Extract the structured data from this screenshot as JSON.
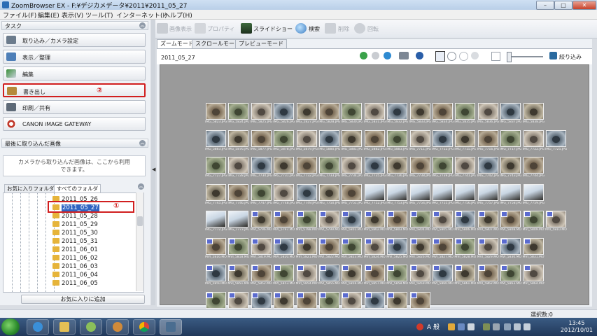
{
  "window": {
    "title": "ZoomBrowser EX  -  F:¥デジカメデータ¥2011¥2011_05_27",
    "min_label": "–",
    "max_label": "□",
    "close_label": "✕"
  },
  "menu": {
    "items": [
      "ファイル(F)",
      "編集(E)",
      "表示(V)",
      "ツール(T)",
      "インターネット(I)",
      "ヘルプ(H)"
    ]
  },
  "left": {
    "task_header": "タスク",
    "tasks": [
      {
        "label": "取り込み／カメラ設定",
        "icon": "camera-import-icon"
      },
      {
        "label": "表示／整理",
        "icon": "view-organize-icon"
      },
      {
        "label": "編集",
        "icon": "edit-icon"
      },
      {
        "label": "書き出し",
        "icon": "export-icon"
      },
      {
        "label": "印刷／共有",
        "icon": "print-icon"
      },
      {
        "label": "CANON iMAGE GATEWAY",
        "icon": "gateway-icon"
      }
    ],
    "export_marker": "②",
    "recent_header": "最後に取り込んだ画像",
    "recent_text_line1": "カメラから取り込んだ画像は、ここから利用",
    "recent_text_line2": "できます。",
    "folder_tabs": [
      "お気に入りフォルダ",
      "すべてのフォルダ"
    ],
    "folders": [
      "2011_05_26",
      "2011_05_27",
      "2011_05_28",
      "2011_05_29",
      "2011_05_30",
      "2011_05_31",
      "2011_06_01",
      "2011_06_02",
      "2011_06_03",
      "2011_06_04",
      "2011_06_05"
    ],
    "selected_folder": "2011_05_27",
    "selected_marker": "①",
    "add_favorite": "お気に入りに追加"
  },
  "toolbar": {
    "view_image": "画像表示",
    "properties": "プロパティ",
    "slideshow": "スライドショー",
    "search": "検索",
    "delete": "削除",
    "rotate": "回転",
    "filter": "絞り込み"
  },
  "main": {
    "tabs": [
      "ズームモード",
      "スクロールモード",
      "プレビューモード"
    ],
    "folder_date": "2011_05_27",
    "status": "選択数:0"
  },
  "thumbnails": {
    "rows": [
      [
        "IMG_5823.JPG",
        "IMG_5824.JPG",
        "IMG_5825.JPG",
        "IMG_5826.JPG",
        "IMG_5827.JPG",
        "IMG_5828.JPG",
        "IMG_5830.JPG",
        "IMG_5831.JPG",
        "IMG_5832.JPG",
        "IMG_5833.JPG",
        "IMG_5834.JPG",
        "IMG_5835.JPG",
        "IMG_5836.JPG",
        "IMG_5837.JPG",
        "IMG_5838.JPG"
      ],
      [
        "IMG_5863.JPG",
        "IMG_5876.JPG",
        "IMG_5877.JPG",
        "IMG_5878.JPG",
        "IMG_5879.JPG",
        "IMG_5880.JPG",
        "IMG_5881.JPG",
        "IMG_5882.JPG",
        "IMG_5883.JPG",
        "IMG_7711.JPG",
        "IMG_7712.JPG",
        "IMG_7715.JPG",
        "IMG_7716.JPG",
        "IMG_7717.JPG",
        "IMG_7722.JPG",
        "IMG_7725.JPG"
      ],
      [
        "IMG_7727.JPG",
        "IMG_7728.JPG",
        "IMG_7730.JPG",
        "IMG_7731.JPG",
        "IMG_7732.JPG",
        "IMG_7733.JPG",
        "IMG_7734.JPG",
        "IMG_7735.JPG",
        "IMG_7736.JPG",
        "IMG_7738.JPG",
        "IMG_7739.JPG",
        "IMG_7741.JPG",
        "IMG_7742.JPG",
        "IMG_7743.JPG",
        "IMG_7744.JPG"
      ],
      [
        "IMG_7745.JPG",
        "IMG_7746.JPG",
        "IMG_7747.JPG",
        "IMG_7748.JPG",
        "IMG_7749.JPG",
        "IMG_7750.JPG",
        "IMG_7751.JPG",
        "IMG_7752.JPG",
        "IMG_7753.JPG",
        "IMG_7754.JPG",
        "IMG_7755.JPG",
        "IMG_7756.JPG",
        "IMG_7757.JPG",
        "IMG_7758.JPG",
        "IMG_7759.JPG"
      ],
      [
        "IMG_7772.JPG",
        "IMG_7773.JPG",
        "MVI_5796.MOV",
        "MVI_5797.MOV",
        "MVI_5798.MOV",
        "MVI_5799.MOV",
        "MVI_5801.MOV",
        "MVI_5802.MOV",
        "MVI_5803.MOV",
        "MVI_5804.MOV",
        "MVI_5805.MOV",
        "MVI_5806.MOV",
        "MVI_5807.MOV",
        "MVI_5808.MOV",
        "MVI_5809.MOV",
        "MVI_5810.MOV"
      ],
      [
        "MVI_5816.MOV",
        "MVI_5818.MOV",
        "MVI_5819.MOV",
        "MVI_5820.MOV",
        "MVI_5821.MOV",
        "MVI_5822.MOV",
        "MVI_5823.MOV",
        "MVI_5824.MOV",
        "MVI_5825.MOV",
        "MVI_5826.MOV",
        "MVI_5827.MOV",
        "MVI_5828.MOV",
        "MVI_5829.MOV",
        "MVI_5830.MOV",
        "MVI_5831.MOV"
      ],
      [
        "MVI_5850.MOV",
        "MVI_5851.MOV",
        "MVI_5852.MOV",
        "MVI_5853.MOV",
        "MVI_5854.MOV",
        "MVI_5855.MOV",
        "MVI_5856.MOV",
        "MVI_5857.MOV",
        "MVI_5858.MOV",
        "MVI_5859.MOV",
        "MVI_5860.MOV",
        "MVI_5861.MOV",
        "MVI_5862.MOV",
        "MVI_5863.MOV",
        "MVI_5864.MOV"
      ],
      [
        "MVI_5888.MOV",
        "MVI_5889.MOV",
        "MVI_5890.MOV",
        "MVI_5891.MOV",
        "MVI_5892.MOV",
        "MVI_5893.MOV",
        "MVI_5894.MOV",
        "MVI_5895.MOV",
        "MVI_5897.MOV",
        "MVI_5898.MOV"
      ]
    ]
  },
  "taskbar": {
    "time": "13:45",
    "date": "2012/10/01",
    "ime": "A 般"
  }
}
